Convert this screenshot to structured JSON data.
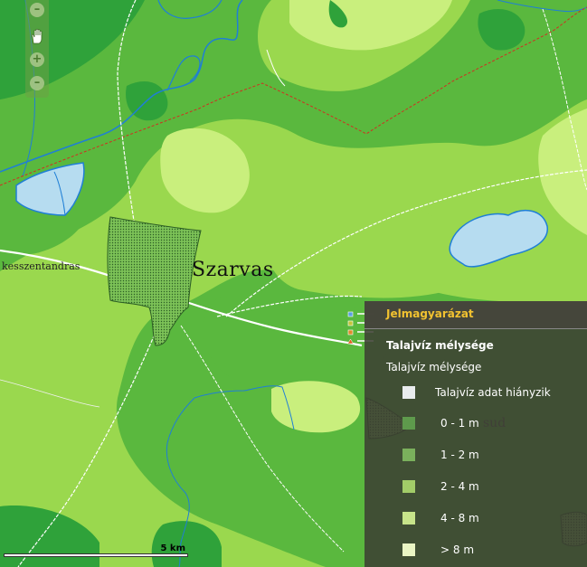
{
  "map": {
    "place_labels": {
      "town": "Szarvas",
      "village": "kesszentandras",
      "faint": "sud"
    },
    "scale_bar": {
      "label": "5 km"
    }
  },
  "toolbar": {
    "zoom_out_label": "–",
    "zoom_in_label": "+",
    "zoom_out2_label": "–"
  },
  "legend": {
    "title": "Jelmagyarázat",
    "layer_title": "Talajvíz mélysége",
    "subtitle": "Talajvíz mélysége",
    "items": [
      {
        "label": "Talajvíz adat hiányzik",
        "color": "#e9ecee"
      },
      {
        "label": "0 - 1 m",
        "color": "#5e9a4c"
      },
      {
        "label": "1 - 2 m",
        "color": "#7ab05c"
      },
      {
        "label": "2 - 4 m",
        "color": "#a2cc68"
      },
      {
        "label": "4 - 8 m",
        "color": "#c7e48a"
      },
      {
        "label": "> 8 m",
        "color": "#eaf5c4"
      }
    ]
  },
  "colors": {
    "zone_0_1": "#2fa23a",
    "zone_1_2": "#5ab83e",
    "zone_2_4": "#9ad84e",
    "zone_4_8": "#c9ef7d",
    "water": "#b6dcf0",
    "river": "#1f7fd6",
    "road": "#ffffff",
    "border": "#d03020",
    "legend_title": "#f2c230"
  }
}
